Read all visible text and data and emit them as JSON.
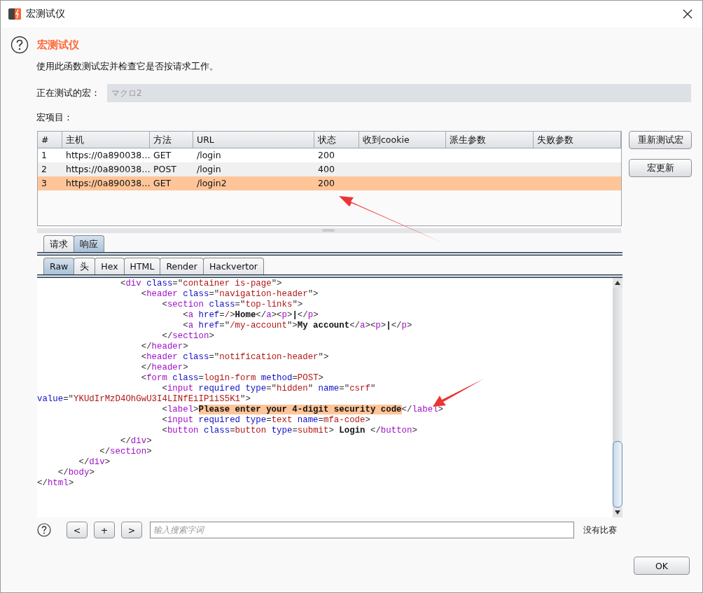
{
  "window": {
    "title": "宏测试仪"
  },
  "heading": "宏测试仪",
  "description": "使用此函数测试宏并检查它是否按请求工作。",
  "macro_field": {
    "label": "正在测试的宏：",
    "value": "マクロ2"
  },
  "items_label": "宏项目：",
  "table": {
    "columns": [
      "#",
      "主机",
      "方法",
      "URL",
      "状态",
      "收到cookie",
      "派生参数",
      "失败参数"
    ],
    "rows": [
      {
        "cells": [
          "1",
          "https://0a890038…",
          "GET",
          "/login",
          "200"
        ],
        "selected": false
      },
      {
        "cells": [
          "2",
          "https://0a890038…",
          "POST",
          "/login",
          "400"
        ],
        "selected": false
      },
      {
        "cells": [
          "3",
          "https://0a890038…",
          "GET",
          "/login2",
          "200"
        ],
        "selected": true
      }
    ]
  },
  "side_buttons": [
    "重新测试宏",
    "宏更新"
  ],
  "tabs": [
    {
      "label": "请求",
      "selected": false
    },
    {
      "label": "响应",
      "selected": true
    }
  ],
  "subtabs": [
    {
      "label": "Raw",
      "selected": true
    },
    {
      "label": "头",
      "selected": false
    },
    {
      "label": "Hex",
      "selected": false
    },
    {
      "label": "HTML",
      "selected": false
    },
    {
      "label": "Render",
      "selected": false
    },
    {
      "label": "Hackvertor",
      "selected": false
    }
  ],
  "code_lines": [
    [
      {
        "kind": "punct",
        "text": "                <"
      },
      {
        "kind": "tag",
        "text": "div"
      },
      {
        "kind": "attr",
        "text": " class"
      },
      {
        "kind": "punct",
        "text": "=\""
      },
      {
        "kind": "value",
        "text": "container is-page"
      },
      {
        "kind": "punct",
        "text": "\">"
      }
    ],
    [
      {
        "kind": "punct",
        "text": "                    <"
      },
      {
        "kind": "tag",
        "text": "header"
      },
      {
        "kind": "attr",
        "text": " class"
      },
      {
        "kind": "punct",
        "text": "=\""
      },
      {
        "kind": "value",
        "text": "navigation-header"
      },
      {
        "kind": "punct",
        "text": "\">"
      }
    ],
    [
      {
        "kind": "punct",
        "text": "                        <"
      },
      {
        "kind": "tag",
        "text": "section"
      },
      {
        "kind": "attr",
        "text": " class"
      },
      {
        "kind": "punct",
        "text": "=\""
      },
      {
        "kind": "value",
        "text": "top-links"
      },
      {
        "kind": "punct",
        "text": "\">"
      }
    ],
    [
      {
        "kind": "punct",
        "text": "                            <"
      },
      {
        "kind": "tag",
        "text": "a"
      },
      {
        "kind": "attr",
        "text": " href"
      },
      {
        "kind": "punct",
        "text": "="
      },
      {
        "kind": "value",
        "text": "/"
      },
      {
        "kind": "punct",
        "text": ">"
      },
      {
        "kind": "text",
        "text": "Home"
      },
      {
        "kind": "punct",
        "text": "</"
      },
      {
        "kind": "tag",
        "text": "a"
      },
      {
        "kind": "punct",
        "text": "><"
      },
      {
        "kind": "tag",
        "text": "p"
      },
      {
        "kind": "punct",
        "text": ">"
      },
      {
        "kind": "text",
        "text": "|"
      },
      {
        "kind": "punct",
        "text": "</"
      },
      {
        "kind": "tag",
        "text": "p"
      },
      {
        "kind": "punct",
        "text": ">"
      }
    ],
    [
      {
        "kind": "punct",
        "text": "                            <"
      },
      {
        "kind": "tag",
        "text": "a"
      },
      {
        "kind": "attr",
        "text": " href"
      },
      {
        "kind": "punct",
        "text": "=\""
      },
      {
        "kind": "value",
        "text": "/my-account"
      },
      {
        "kind": "punct",
        "text": "\">"
      },
      {
        "kind": "text",
        "text": "My account"
      },
      {
        "kind": "punct",
        "text": "</"
      },
      {
        "kind": "tag",
        "text": "a"
      },
      {
        "kind": "punct",
        "text": "><"
      },
      {
        "kind": "tag",
        "text": "p"
      },
      {
        "kind": "punct",
        "text": ">"
      },
      {
        "kind": "text",
        "text": "|"
      },
      {
        "kind": "punct",
        "text": "</"
      },
      {
        "kind": "tag",
        "text": "p"
      },
      {
        "kind": "punct",
        "text": ">"
      }
    ],
    [
      {
        "kind": "punct",
        "text": "                        </"
      },
      {
        "kind": "tag",
        "text": "section"
      },
      {
        "kind": "punct",
        "text": ">"
      }
    ],
    [
      {
        "kind": "punct",
        "text": "                    </"
      },
      {
        "kind": "tag",
        "text": "header"
      },
      {
        "kind": "punct",
        "text": ">"
      }
    ],
    [
      {
        "kind": "punct",
        "text": "                    <"
      },
      {
        "kind": "tag",
        "text": "header"
      },
      {
        "kind": "attr",
        "text": " class"
      },
      {
        "kind": "punct",
        "text": "=\""
      },
      {
        "kind": "value",
        "text": "notification-header"
      },
      {
        "kind": "punct",
        "text": "\">"
      }
    ],
    [
      {
        "kind": "punct",
        "text": "                    </"
      },
      {
        "kind": "tag",
        "text": "header"
      },
      {
        "kind": "punct",
        "text": ">"
      }
    ],
    [
      {
        "kind": "punct",
        "text": "                    <"
      },
      {
        "kind": "tag",
        "text": "form"
      },
      {
        "kind": "attr",
        "text": " class"
      },
      {
        "kind": "punct",
        "text": "="
      },
      {
        "kind": "value",
        "text": "login-form"
      },
      {
        "kind": "attr",
        "text": " method"
      },
      {
        "kind": "punct",
        "text": "="
      },
      {
        "kind": "value",
        "text": "POST"
      },
      {
        "kind": "punct",
        "text": ">"
      }
    ],
    [
      {
        "kind": "punct",
        "text": "                        <"
      },
      {
        "kind": "tag",
        "text": "input"
      },
      {
        "kind": "attr",
        "text": " required type"
      },
      {
        "kind": "punct",
        "text": "=\""
      },
      {
        "kind": "value",
        "text": "hidden"
      },
      {
        "kind": "punct",
        "text": "\""
      },
      {
        "kind": "attr",
        "text": " name"
      },
      {
        "kind": "punct",
        "text": "=\""
      },
      {
        "kind": "value",
        "text": "csrf"
      },
      {
        "kind": "punct",
        "text": "\""
      }
    ],
    [
      {
        "kind": "attr",
        "text": "value"
      },
      {
        "kind": "punct",
        "text": "=\""
      },
      {
        "kind": "value",
        "text": "YKUdIrMzD4OhGwU3I4LINfEiIP1iS5K1"
      },
      {
        "kind": "punct",
        "text": "\">"
      }
    ],
    [
      {
        "kind": "punct",
        "text": "                        <"
      },
      {
        "kind": "tag",
        "text": "label"
      },
      {
        "kind": "punct",
        "text": ">"
      },
      {
        "kind": "mark",
        "text": "Please enter your 4-digit security code"
      },
      {
        "kind": "punct",
        "text": "</"
      },
      {
        "kind": "tag",
        "text": "label"
      },
      {
        "kind": "punct",
        "text": ">"
      }
    ],
    [
      {
        "kind": "punct",
        "text": "                        <"
      },
      {
        "kind": "tag",
        "text": "input"
      },
      {
        "kind": "attr",
        "text": " required type"
      },
      {
        "kind": "punct",
        "text": "="
      },
      {
        "kind": "value",
        "text": "text"
      },
      {
        "kind": "attr",
        "text": " name"
      },
      {
        "kind": "punct",
        "text": "="
      },
      {
        "kind": "value",
        "text": "mfa-code"
      },
      {
        "kind": "punct",
        "text": ">"
      }
    ],
    [
      {
        "kind": "punct",
        "text": "                        <"
      },
      {
        "kind": "tag",
        "text": "button"
      },
      {
        "kind": "attr",
        "text": " class"
      },
      {
        "kind": "punct",
        "text": "="
      },
      {
        "kind": "value",
        "text": "button"
      },
      {
        "kind": "attr",
        "text": " type"
      },
      {
        "kind": "punct",
        "text": "="
      },
      {
        "kind": "value",
        "text": "submit"
      },
      {
        "kind": "punct",
        "text": "> "
      },
      {
        "kind": "text",
        "text": "Login"
      },
      {
        "kind": "punct",
        "text": " </"
      },
      {
        "kind": "tag",
        "text": "button"
      },
      {
        "kind": "punct",
        "text": ">"
      }
    ],
    [
      {
        "kind": "punct",
        "text": "                </"
      },
      {
        "kind": "tag",
        "text": "div"
      },
      {
        "kind": "punct",
        "text": ">"
      }
    ],
    [
      {
        "kind": "punct",
        "text": "            </"
      },
      {
        "kind": "tag",
        "text": "section"
      },
      {
        "kind": "punct",
        "text": ">"
      }
    ],
    [
      {
        "kind": "punct",
        "text": "        </"
      },
      {
        "kind": "tag",
        "text": "div"
      },
      {
        "kind": "punct",
        "text": ">"
      }
    ],
    [
      {
        "kind": "punct",
        "text": "    </"
      },
      {
        "kind": "tag",
        "text": "body"
      },
      {
        "kind": "punct",
        "text": ">"
      }
    ],
    [
      {
        "kind": "punct",
        "text": "</"
      },
      {
        "kind": "tag",
        "text": "html"
      },
      {
        "kind": "punct",
        "text": ">"
      }
    ]
  ],
  "search": {
    "buttons": [
      "<",
      "+",
      ">"
    ],
    "placeholder": "输入搜索字词",
    "status": "没有比赛"
  },
  "ok_button": "OK"
}
